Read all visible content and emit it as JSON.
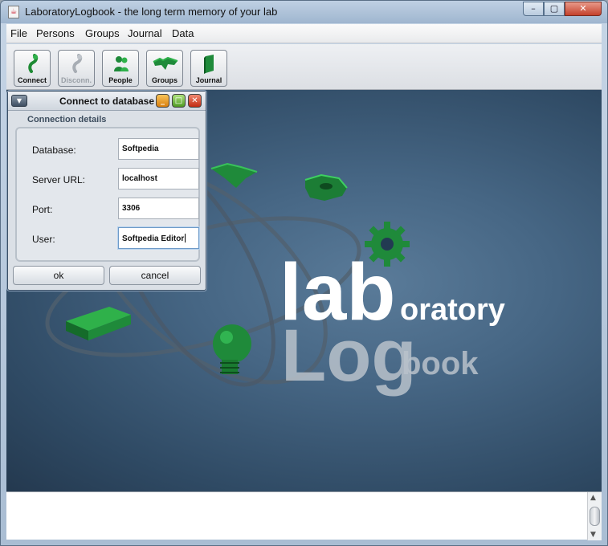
{
  "window": {
    "title": "LaboratoryLogbook - the long term memory of your lab",
    "app_icon": "java-cup-icon",
    "controls": {
      "minimize": "–",
      "maximize": "▢",
      "close": "✕"
    }
  },
  "menu": [
    {
      "label": "File"
    },
    {
      "label": "Persons"
    },
    {
      "label": "Groups"
    },
    {
      "label": "Journal"
    },
    {
      "label": "Data"
    }
  ],
  "toolbar": [
    {
      "label": "Connect",
      "icon": "connect-plug-icon",
      "enabled": true
    },
    {
      "label": "Disconn.",
      "icon": "disconnect-plug-icon",
      "enabled": false
    },
    {
      "label": "People",
      "icon": "people-icon",
      "enabled": true
    },
    {
      "label": "Groups",
      "icon": "groups-puzzle-icon",
      "enabled": true
    },
    {
      "label": "Journal",
      "icon": "journal-book-icon",
      "enabled": true
    }
  ],
  "splash": {
    "big1": "lab",
    "small1": "oratory",
    "big2": "Log",
    "small2": "book"
  },
  "dialog": {
    "title": "Connect to database",
    "section": "Connection details",
    "fields": [
      {
        "label": "Database:",
        "value": "Softpedia"
      },
      {
        "label": "Server URL:",
        "value": "localhost"
      },
      {
        "label": "Port:",
        "value": "3306"
      },
      {
        "label": "User:",
        "value": "Softpedia Editor"
      }
    ],
    "ok_label": "ok",
    "cancel_label": "cancel"
  },
  "colors": {
    "accent_green": "#1f8a3a",
    "background_blue": "#3f5f7c"
  }
}
